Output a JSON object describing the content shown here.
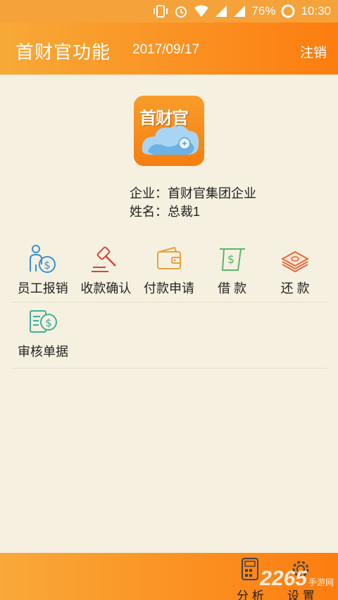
{
  "status": {
    "battery": "76%",
    "time": "10:30"
  },
  "header": {
    "title": "首财官功能",
    "date": "2017/09/17",
    "logout": "注销"
  },
  "logo": {
    "text": "首财官"
  },
  "info": {
    "company_label": "企业：",
    "company_value": "首财官集团企业",
    "name_label": "姓名：",
    "name_value": "总裁1"
  },
  "functions": [
    {
      "label": "员工报销",
      "icon": "employee-money-icon"
    },
    {
      "label": "收款确认",
      "icon": "gavel-icon"
    },
    {
      "label": "付款申请",
      "icon": "wallet-icon"
    },
    {
      "label": "借 款",
      "icon": "bill-icon"
    },
    {
      "label": "还 款",
      "icon": "cash-stack-icon"
    },
    {
      "label": "审核单据",
      "icon": "document-dollar-icon"
    }
  ],
  "bottom": {
    "analysis": "分 析",
    "settings": "设 置"
  },
  "watermark": {
    "text": "2265",
    "small": "手游网"
  },
  "colors": {
    "accent": "#fb8f20",
    "background": "#f6f0e0"
  }
}
